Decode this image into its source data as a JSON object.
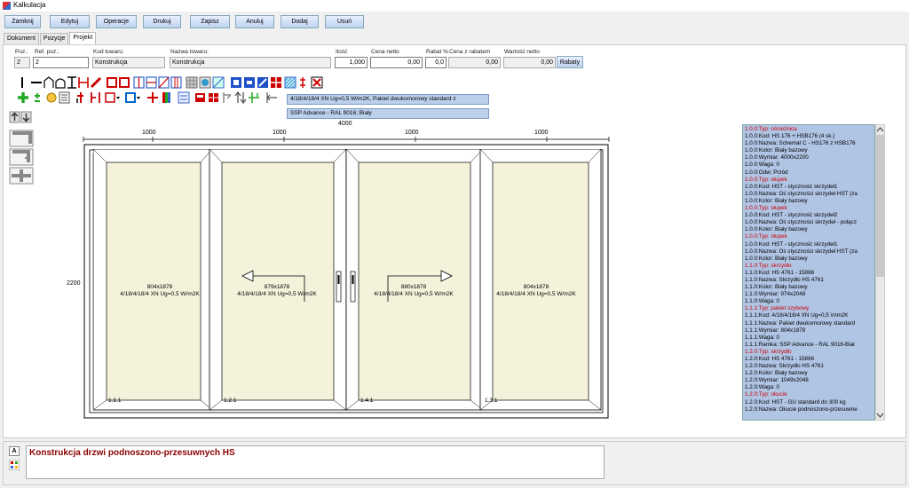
{
  "window": {
    "title": "Kalkulacja"
  },
  "toolbar": [
    "Zamknij",
    "Edytuj",
    "Operacje",
    "Drukuj",
    "Zapisz",
    "Anuluj",
    "Dodaj",
    "Usuń"
  ],
  "tabs": [
    {
      "label": "Dokument",
      "active": false
    },
    {
      "label": "Pozycje",
      "active": false
    },
    {
      "label": "Projekt",
      "active": true
    }
  ],
  "form": {
    "poz_label": "Poz.:",
    "poz_value": "2",
    "ref_label": "Ref. poz.:",
    "ref_value": "2",
    "kod_label": "Kod towaru:",
    "kod_value": "Konstrukcja",
    "nazwa_label": "Nazwa towaru:",
    "nazwa_value": "Konstrukcja",
    "ilosc_label": "Ilość",
    "ilosc_value": "1,000",
    "cena_label": "Cena netto",
    "cena_value": "0,00",
    "rabat_label": "Rabat %",
    "rabat_value": "0,0",
    "cena_rab_label": "Cena z rabatem",
    "cena_rab_value": "0,00",
    "wartosc_label": "Wartość netto",
    "wartosc_value": "0,00",
    "rabaty_button": "Rabaty"
  },
  "combos": {
    "glass": "4/18/4/18/4 XN Ug=0,5 W/m2K, Pakiet dwukomorowy standard z",
    "frame": "SSP Advance - RAL 9016; Biały"
  },
  "drawing": {
    "total_width": "4000",
    "section_widths": [
      "1000",
      "1000",
      "1000",
      "1000"
    ],
    "height": "2200",
    "sashes": [
      {
        "size": "804x1878",
        "glass": "4/18/4/18/4 XN Ug=0,5 W/m2K",
        "pos": "1.1.1",
        "arrow": ""
      },
      {
        "size": "879x1878",
        "glass": "4/18/4/18/4 XN Ug=0,5 W/m2K",
        "pos": "1.2.1",
        "arrow": "left"
      },
      {
        "size": "880x1878",
        "glass": "4/18/4/18/4 XN Ug=0,5 W/m2K",
        "pos": "1.4.1",
        "arrow": "right"
      },
      {
        "size": "804x1878",
        "glass": "4/18/4/18/4 XN Ug=0,5 W/m2K",
        "pos": "1.3.1",
        "arrow": ""
      }
    ]
  },
  "properties": [
    {
      "text": "1.0.0:Typ: ościeżnica",
      "header": true
    },
    {
      "text": "1.0.0:Kod: HS 176 + HSB176 (4 sk.)",
      "header": false
    },
    {
      "text": "1.0.0:Nazwa: Schemat C - HS176 z HSB176",
      "header": false
    },
    {
      "text": "1.0.0:Kolor: Biały bazowy",
      "header": false
    },
    {
      "text": "1.0.0:Wymiar: 4000x2200",
      "header": false
    },
    {
      "text": "1.0.0:Waga: 0",
      "header": false
    },
    {
      "text": "1.0.0:Odw: Przód",
      "header": false
    },
    {
      "text": "1.0.0:Typ: słupek",
      "header": true
    },
    {
      "text": "1.0.0:Kod: HST - styczność skrzydeł1",
      "header": false
    },
    {
      "text": "1.0.0:Nazwa: Oś styczności skrzydeł HST (za",
      "header": false
    },
    {
      "text": "1.0.0:Kolor: Biały bazowy",
      "header": false
    },
    {
      "text": "1.0.0:Typ: słupek",
      "header": true
    },
    {
      "text": "1.0.0:Kod: HST - styczność skrzydeł2",
      "header": false
    },
    {
      "text": "1.0.0:Nazwa: Oś styczności skrzydeł - połącz",
      "header": false
    },
    {
      "text": "1.0.0:Kolor: Biały bazowy",
      "header": false
    },
    {
      "text": "1.0.0:Typ: słupek",
      "header": true
    },
    {
      "text": "1.0.0:Kod: HST - styczność skrzydeł1",
      "header": false
    },
    {
      "text": "1.0.0:Nazwa: Oś styczności skrzydeł HST (za",
      "header": false
    },
    {
      "text": "1.0.0:Kolor: Biały bazowy",
      "header": false
    },
    {
      "text": "1.1.0:Typ: skrzydło",
      "header": true
    },
    {
      "text": "1.1.0:Kod: HS 4761 - 15866",
      "header": false
    },
    {
      "text": "1.1.0:Nazwa: Skrzydło HS 4761",
      "header": false
    },
    {
      "text": "1.1.0:Kolor: Biały bazowy",
      "header": false
    },
    {
      "text": "1.1.0:Wymiar: 974x2048",
      "header": false
    },
    {
      "text": "1.1.0:Waga: 0",
      "header": false
    },
    {
      "text": "1.1.1:Typ: pakiet szybowy",
      "header": true
    },
    {
      "text": "1.1.1:Kod: 4/18/4/18/4 XN Ug=0,5 \\n\\m2K",
      "header": false
    },
    {
      "text": "1.1.1:Nazwa: Pakiet dwukomorowy standard",
      "header": false
    },
    {
      "text": "1.1.1:Wymiar: 804x1878",
      "header": false
    },
    {
      "text": "1.1.1:Waga: 0",
      "header": false
    },
    {
      "text": "1.1.1:Ramka: SSP Advance - RAL 9016-Biał",
      "header": false
    },
    {
      "text": "1.2.0:Typ: skrzydło",
      "header": true
    },
    {
      "text": "1.2.0:Kod: HS 4761 - 15866",
      "header": false
    },
    {
      "text": "1.2.0:Nazwa: Skrzydło HS 4761",
      "header": false
    },
    {
      "text": "1.2.0:Kolor: Biały bazowy",
      "header": false
    },
    {
      "text": "1.2.0:Wymiar: 1049x2048",
      "header": false
    },
    {
      "text": "1.2.0:Waga: 0",
      "header": false
    },
    {
      "text": "1.2.0:Typ: okucie",
      "header": true
    },
    {
      "text": "1.2.0:Kod: HST - GU standard do 300 kg",
      "header": false
    },
    {
      "text": "1.2.0:Nazwa: Okucie podnoszono-przesuwne",
      "header": false
    }
  ],
  "bottom": {
    "a_button": "A",
    "description": "Konstrukcja drzwi podnoszono-przesuwnych HS"
  },
  "colors": {
    "glass_fill": "#f5f2dc",
    "list_bg": "#b0c4e4",
    "header_red": "#c00000"
  }
}
